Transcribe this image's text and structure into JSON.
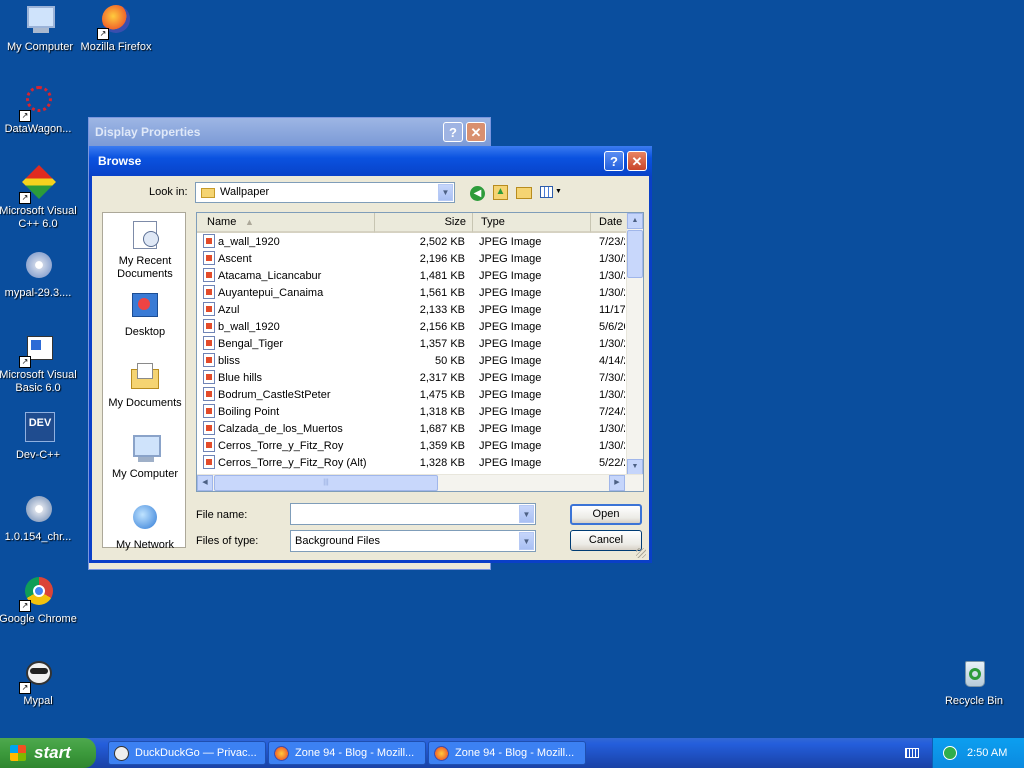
{
  "desktop": {
    "icons": [
      {
        "label": "My Computer"
      },
      {
        "label": "Mozilla Firefox"
      },
      {
        "label": "DataWagon..."
      },
      {
        "label": "Microsoft Visual C++ 6.0"
      },
      {
        "label": "mypal-29.3...."
      },
      {
        "label": "Microsoft Visual Basic 6.0"
      },
      {
        "label": "Dev-C++"
      },
      {
        "label": "1.0.154_chr..."
      },
      {
        "label": "Google Chrome"
      },
      {
        "label": "Mypal"
      },
      {
        "label": "Recycle Bin"
      }
    ],
    "dev_badge": "DEV"
  },
  "display_properties": {
    "title": "Display Properties",
    "help": "?",
    "close": "✕"
  },
  "browse": {
    "title": "Browse",
    "help": "?",
    "close": "✕",
    "look_in_label": "Look in:",
    "look_in_value": "Wallpaper",
    "places": [
      {
        "label": "My Recent Documents"
      },
      {
        "label": "Desktop"
      },
      {
        "label": "My Documents"
      },
      {
        "label": "My Computer"
      },
      {
        "label": "My Network"
      }
    ],
    "columns": {
      "name": "Name",
      "size": "Size",
      "type": "Type",
      "date": "Date"
    },
    "files": [
      {
        "name": "a_wall_1920",
        "size": "2,502 KB",
        "type": "JPEG Image",
        "date": "7/23/2"
      },
      {
        "name": "Ascent",
        "size": "2,196 KB",
        "type": "JPEG Image",
        "date": "1/30/2"
      },
      {
        "name": "Atacama_Licancabur",
        "size": "1,481 KB",
        "type": "JPEG Image",
        "date": "1/30/2"
      },
      {
        "name": "Auyantepui_Canaima",
        "size": "1,561 KB",
        "type": "JPEG Image",
        "date": "1/30/2"
      },
      {
        "name": "Azul",
        "size": "2,133 KB",
        "type": "JPEG Image",
        "date": "11/17"
      },
      {
        "name": "b_wall_1920",
        "size": "2,156 KB",
        "type": "JPEG Image",
        "date": "5/6/20"
      },
      {
        "name": "Bengal_Tiger",
        "size": "1,357 KB",
        "type": "JPEG Image",
        "date": "1/30/2"
      },
      {
        "name": "bliss",
        "size": "50 KB",
        "type": "JPEG Image",
        "date": "4/14/2"
      },
      {
        "name": "Blue hills",
        "size": "2,317 KB",
        "type": "JPEG Image",
        "date": "7/30/2"
      },
      {
        "name": "Bodrum_CastleStPeter",
        "size": "1,475 KB",
        "type": "JPEG Image",
        "date": "1/30/2"
      },
      {
        "name": "Boiling Point",
        "size": "1,318 KB",
        "type": "JPEG Image",
        "date": "7/24/2"
      },
      {
        "name": "Calzada_de_los_Muertos",
        "size": "1,687 KB",
        "type": "JPEG Image",
        "date": "1/30/2"
      },
      {
        "name": "Cerros_Torre_y_Fitz_Roy",
        "size": "1,359 KB",
        "type": "JPEG Image",
        "date": "1/30/2"
      },
      {
        "name": "Cerros_Torre_y_Fitz_Roy (Alt)",
        "size": "1,328 KB",
        "type": "JPEG Image",
        "date": "5/22/2"
      }
    ],
    "file_name_label": "File name:",
    "file_name_value": "",
    "files_of_type_label": "Files of type:",
    "files_of_type_value": "Background Files",
    "open_label": "Open",
    "cancel_label": "Cancel",
    "scroll_grip": "|||"
  },
  "taskbar": {
    "start_label": "start",
    "tasks": [
      {
        "label": "DuckDuckGo — Privac..."
      },
      {
        "label": "Zone 94 - Blog - Mozill..."
      },
      {
        "label": "Zone 94 - Blog - Mozill..."
      }
    ],
    "clock": "2:50 AM"
  },
  "colors": {
    "desktop": "#0a4e9e",
    "title_active": "#0a52e0",
    "start_green": "#3c9a3c"
  }
}
